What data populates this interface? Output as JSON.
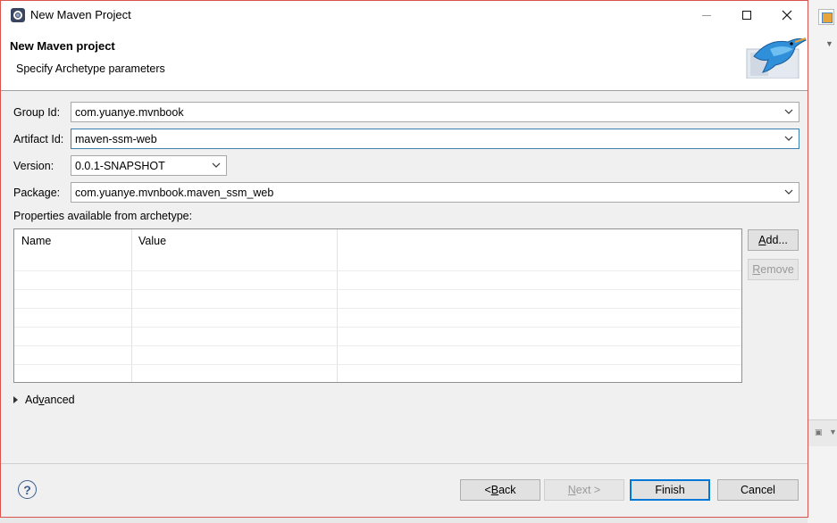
{
  "window": {
    "title": "New Maven Project",
    "app_icon": "eclipse-icon"
  },
  "header": {
    "title": "New Maven project",
    "subtitle": "Specify Archetype parameters",
    "logo_icon": "maven-bird-logo"
  },
  "form": {
    "group_id": {
      "label": "Group Id:",
      "value": "com.yuanye.mvnbook"
    },
    "artifact_id": {
      "label": "Artifact Id:",
      "value": "maven-ssm-web"
    },
    "version": {
      "label": "Version:",
      "value": "0.0.1-SNAPSHOT"
    },
    "package": {
      "label": "Package:",
      "value": "com.yuanye.mvnbook.maven_ssm_web"
    }
  },
  "properties": {
    "label": "Properties available from archetype:",
    "columns": [
      "Name",
      "Value"
    ],
    "rows": []
  },
  "side_buttons": {
    "add": {
      "pre": "",
      "mnemonic": "A",
      "post": "dd..."
    },
    "remove": {
      "pre": "",
      "mnemonic": "R",
      "post": "emove"
    }
  },
  "advanced": {
    "pre": "Ad",
    "mnemonic": "v",
    "post": "anced"
  },
  "footer": {
    "back": {
      "pre": "< ",
      "mnemonic": "B",
      "post": "ack"
    },
    "next": {
      "pre": "",
      "mnemonic": "N",
      "post": "ext >"
    },
    "finish": "Finish",
    "cancel": "Cancel",
    "help_icon": "help-icon"
  },
  "colors": {
    "accent": "#0078d7",
    "dialog_border": "#d9534f",
    "focus_border": "#3c7fb1"
  }
}
